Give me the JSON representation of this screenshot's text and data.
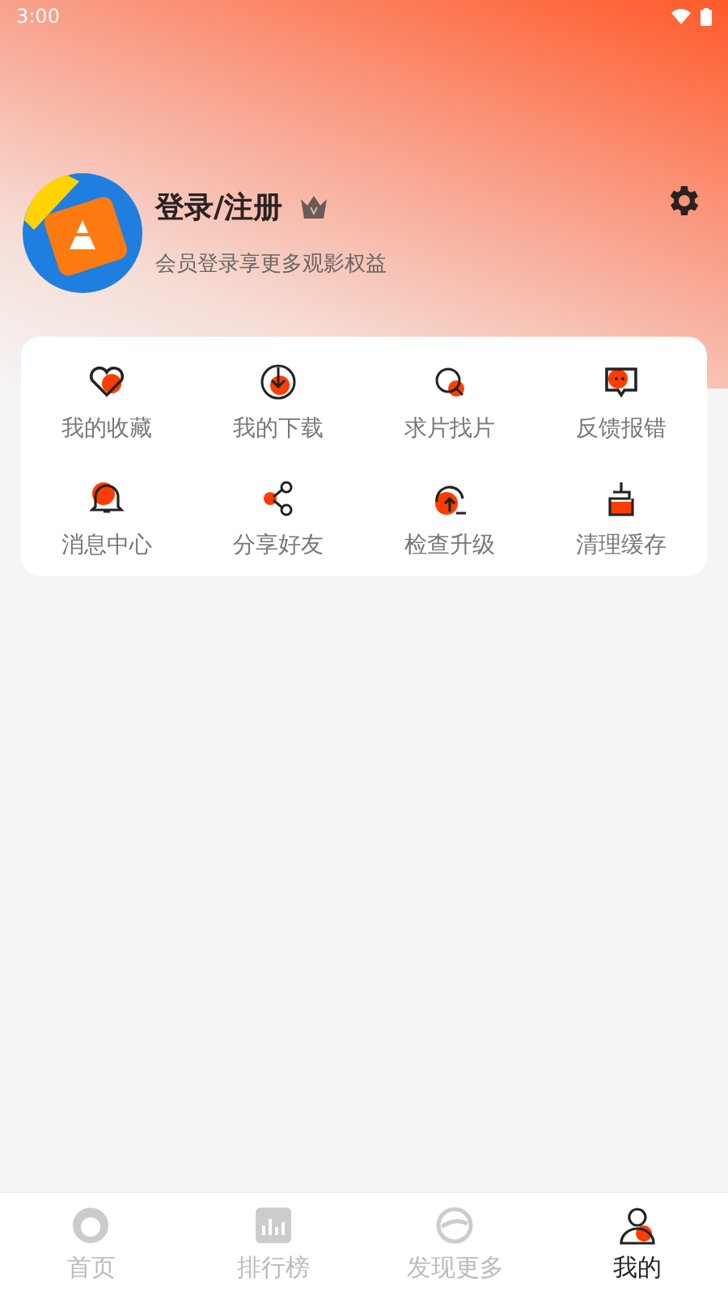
{
  "status_bar": {
    "time": "3:00"
  },
  "profile": {
    "title": "登录/注册",
    "subtitle": "会员登录享更多观影权益"
  },
  "menu": [
    {
      "label": "我的收藏"
    },
    {
      "label": "我的下载"
    },
    {
      "label": "求片找片"
    },
    {
      "label": "反馈报错"
    },
    {
      "label": "消息中心"
    },
    {
      "label": "分享好友"
    },
    {
      "label": "检查升级"
    },
    {
      "label": "清理缓存"
    }
  ],
  "tabs": [
    {
      "label": "首页",
      "selected": false
    },
    {
      "label": "排行榜",
      "selected": false
    },
    {
      "label": "发现更多",
      "selected": false
    },
    {
      "label": "我的",
      "selected": true
    }
  ]
}
